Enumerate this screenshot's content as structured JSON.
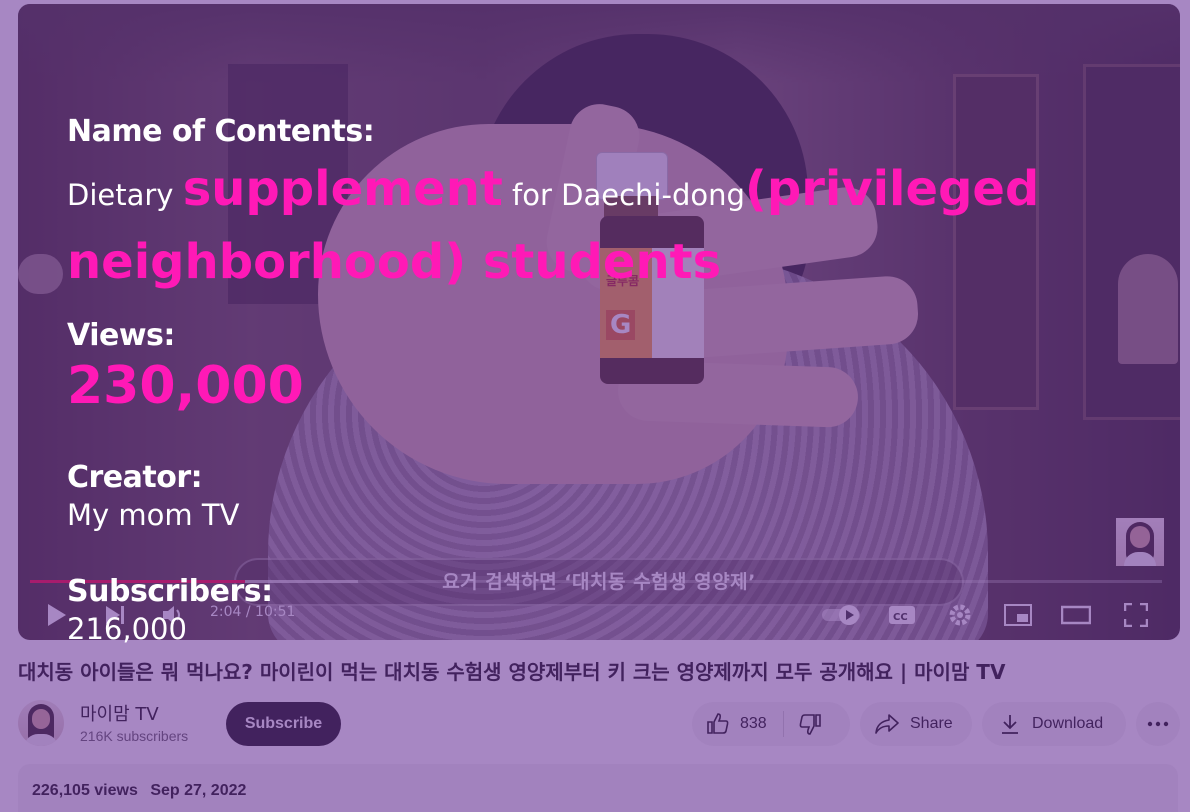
{
  "overlay": {
    "name_label": "Name of Contents:",
    "title_parts": {
      "p1": "Dietary ",
      "p2": "supplement",
      "p3": " for Daechi-dong",
      "p4": "(privileged neighborhood) students"
    },
    "views_label": "Views:",
    "views_value": "230,000",
    "creator_label": "Creator:",
    "creator_value": "My mom TV",
    "subscribers_label": "Subscribers:",
    "subscribers_value": "216,000",
    "tint_color": "#6830a0",
    "accent_color": "#ff19b6"
  },
  "player": {
    "caption": "요거 검색하면 ‘대치동 수험생 영양제’",
    "time": "2:04 / 10:51",
    "progress_fraction": 0.19,
    "buffer_fraction": 0.29,
    "bottle_brand": "글루콤",
    "bottle_letter": "G",
    "icons": [
      "play-icon",
      "next-icon",
      "volume-icon",
      "autoplay-toggle-icon",
      "captions-icon",
      "settings-icon",
      "miniplayer-icon",
      "theater-icon",
      "fullscreen-icon"
    ]
  },
  "video": {
    "title": "대치동 아이들은 뭐 먹나요? 마이린이 먹는 대치동 수험생 영양제부터 키 크는 영양제까지 모두 공개해요 | 마이맘 TV",
    "channel_name": "마이맘 TV",
    "channel_subs": "216K subscribers",
    "subscribe_label": "Subscribe",
    "like_count": "838",
    "share_label": "Share",
    "download_label": "Download",
    "views": "226,105 views",
    "date": "Sep 27, 2022"
  }
}
